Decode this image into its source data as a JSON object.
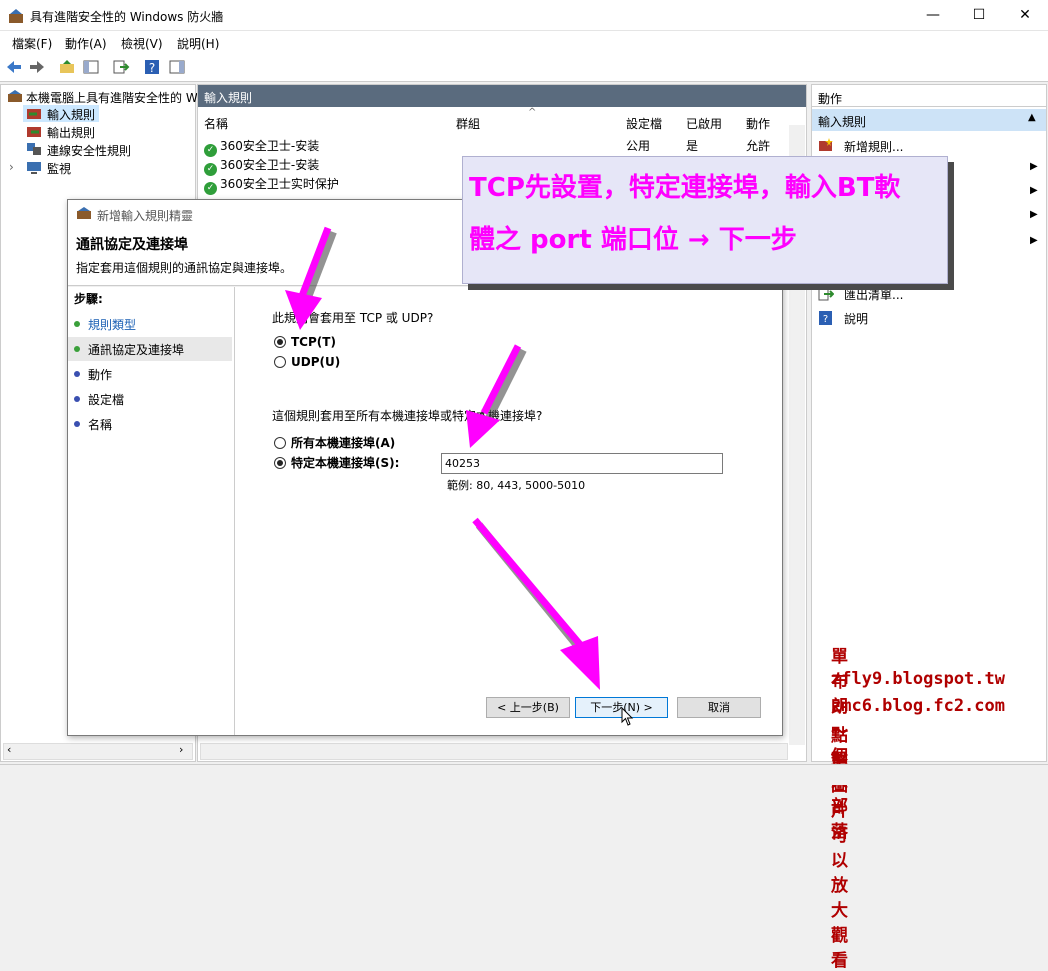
{
  "window": {
    "title": "具有進階安全性的 Windows 防火牆",
    "min": "—",
    "max": "☐",
    "close": "✕"
  },
  "menu": [
    "檔案(F)",
    "動作(A)",
    "檢視(V)",
    "說明(H)"
  ],
  "tree": {
    "root": "本機電腦上具有進階安全性的 W",
    "items": [
      "輸入規則",
      "輸出規則",
      "連線安全性規則",
      "監視"
    ]
  },
  "list": {
    "header": "輸入規則",
    "columns": [
      "名稱",
      "群組",
      "設定檔",
      "已啟用",
      "動作"
    ],
    "rows": [
      {
        "name": "360安全卫士-安装",
        "profile": "公用",
        "enabled": "是",
        "action": "允許"
      },
      {
        "name": "360安全卫士-安装",
        "profile": "",
        "enabled": "",
        "action": ""
      },
      {
        "name": "360安全卫士实时保护",
        "profile": "",
        "enabled": "",
        "action": ""
      }
    ]
  },
  "actions": {
    "header": "動作",
    "selected": "輸入規則",
    "items": [
      "新增規則...",
      "匯出清單...",
      "說明"
    ]
  },
  "dialog": {
    "title": "新增輸入規則精靈",
    "heading": "通訊協定及連接埠",
    "subheading": "指定套用這個規則的通訊協定與連接埠。",
    "steps_label": "步驟:",
    "steps": [
      "規則類型",
      "通訊協定及連接埠",
      "動作",
      "設定檔",
      "名稱"
    ],
    "q1": "此規則會套用至 TCP 或 UDP?",
    "tcp": "TCP(T)",
    "udp": "UDP(U)",
    "q2": "這個規則套用至所有本機連接埠或特定本機連接埠?",
    "all_ports": "所有本機連接埠(A)",
    "specific_ports": "特定本機連接埠(S):",
    "port_value": "40253",
    "example": "範例: 80, 443, 5000-5010",
    "back": "< 上一步(B)",
    "next": "下一步(N) >",
    "cancel": "取消"
  },
  "callout": {
    "line1": "TCP先設置，特定連接埠，輸入BT軟",
    "line2": "體之 port 端口位 → 下一步"
  },
  "signature": [
    "單布朗～個人部落",
    "zfly9.blogspot.tw",
    "zmc6.blog.fc2.com",
    "點擊圖片可以放大觀看"
  ],
  "colors": {
    "accent": "#ff00ff",
    "list_header": "#5a6b7e",
    "selection": "#cde3f7",
    "signature": "#b00000"
  }
}
